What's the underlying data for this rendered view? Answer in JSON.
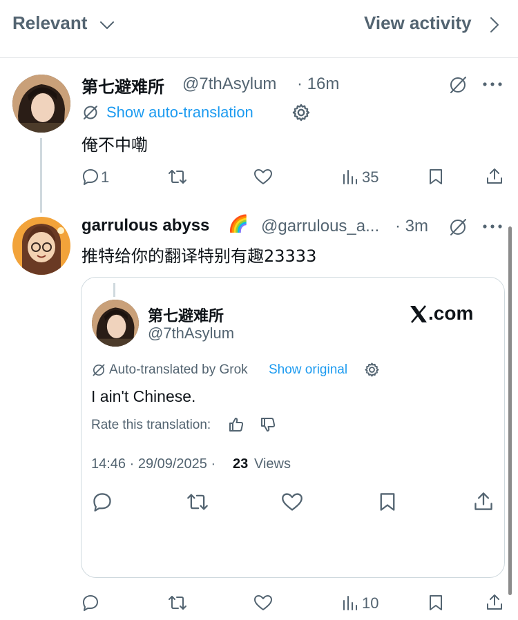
{
  "header": {
    "sort_label": "Relevant",
    "view_activity_label": "View activity"
  },
  "tweet1": {
    "display_name": "第七避难所",
    "handle": "@7thAsylum",
    "time": "· 16m",
    "show_translation_label": "Show auto-translation",
    "text": "俺不中嘞",
    "replies": "1",
    "views": "35"
  },
  "tweet2": {
    "display_name": "garrulous abyss",
    "emoji": "🌈",
    "handle": "@garrulous_a...",
    "time": "· 3m",
    "text": "推特给你的翻译特别有趣23333",
    "views": "10"
  },
  "embed": {
    "display_name": "第七避难所",
    "handle": "@7thAsylum",
    "brand": ".com",
    "translated_by": "Auto-translated by Grok",
    "show_original_label": "Show original",
    "text": "I ain't Chinese.",
    "rate_label": "Rate this translation:",
    "timestamp": "14:46 · 29/09/2025 ·",
    "view_count": "23",
    "views_label": "Views"
  },
  "colors": {
    "link": "#1d9bf0",
    "muted": "#536471",
    "text": "#0f1419",
    "border": "#cfd9de"
  },
  "icons": [
    "chevron-down-icon",
    "chevron-right-icon",
    "translate-icon",
    "more-icon",
    "gear-icon",
    "reply-icon",
    "retweet-icon",
    "like-icon",
    "views-icon",
    "bookmark-icon",
    "share-icon",
    "thumbs-up-icon",
    "thumbs-down-icon",
    "x-logo-icon"
  ]
}
